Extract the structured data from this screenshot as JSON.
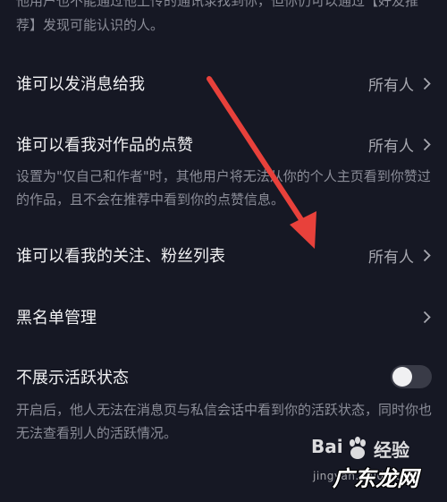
{
  "top_description": "他用户也不能通过他上传的通讯录找到你，但你仍可以通过【好友推荐】发现可能认识的人。",
  "rows": [
    {
      "label": "谁可以发消息给我",
      "value": "所有人"
    },
    {
      "label": "谁可以看我对作品的点赞",
      "value": "所有人"
    },
    {
      "label": "谁可以看我的关注、粉丝列表",
      "value": "所有人"
    },
    {
      "label": "黑名单管理",
      "value": ""
    },
    {
      "label": "不展示活跃状态"
    }
  ],
  "likes_description": "设置为\"仅自己和作者\"时，其他用户将无法从你的个人主页看到你赞过的作品，且不会在推荐中看到你的点赞信息。",
  "active_status": {
    "enabled": false,
    "description": "开启后，他人无法在消息页与私信会话中看到你的活跃状态，同时你也无法查看别人的活跃情况。"
  },
  "watermark": {
    "brand": "Bai",
    "brand_suffix": "经验",
    "url": "jingyan.baidu.com",
    "site": "广东龙网"
  },
  "colors": {
    "background": "#161824",
    "arrow": "#e8413b",
    "toggle_off_track": "#393b47"
  },
  "icons": [
    "chevron-right-icon",
    "annotation-arrow",
    "baidu-paw-logo"
  ]
}
